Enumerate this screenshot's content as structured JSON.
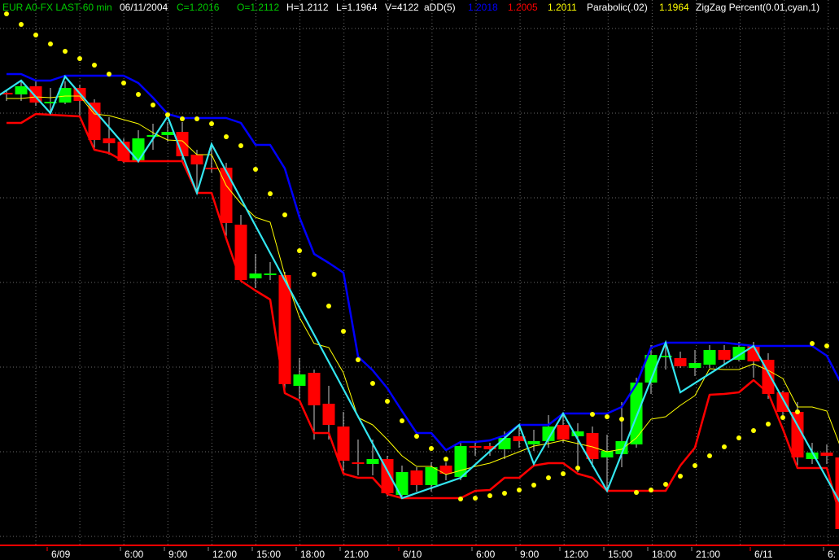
{
  "header": {
    "symbol": "EUR A0-FX LAST-60 min",
    "date": "06/11/2004",
    "close": "C=1.2016",
    "open": "O=1.2112",
    "high": "H=1.2112",
    "low": "L=1.1964",
    "volume": "V=4122",
    "add_label": "aDD(5)",
    "add_upper": "1.2018",
    "add_lower": "1.2005",
    "add_mid": "1.2011",
    "parabolic_label": "Parabolic(.02)",
    "parabolic_value": "1.1964",
    "zigzag_label": "ZigZag Percent(0.01,cyan,1)"
  },
  "colors": {
    "background": "#000000",
    "up": "#00ff00",
    "down": "#ff0000",
    "wick": "#c8c8c8",
    "upper_band": "#0000ff",
    "lower_band": "#ff0000",
    "mid_line": "#ffff00",
    "parabolic": "#ffff00",
    "zigzag": "#33e6f0",
    "header_green": "#00cc00",
    "text": "#ffffff"
  },
  "chart_data": {
    "type": "candlestick",
    "title": "EUR A0-FX LAST-60 min",
    "ylim": [
      1.19,
      1.2229
    ],
    "grid": true,
    "x_labels": [
      {
        "text": "6/09",
        "bar": 3,
        "date": true
      },
      {
        "text": "6:00",
        "bar": 8
      },
      {
        "text": "9:00",
        "bar": 11
      },
      {
        "text": "12:00",
        "bar": 14
      },
      {
        "text": "15:00",
        "bar": 17
      },
      {
        "text": "18:00",
        "bar": 20
      },
      {
        "text": "21:00",
        "bar": 23
      },
      {
        "text": "6/10",
        "bar": 27,
        "date": true
      },
      {
        "text": "6:00",
        "bar": 32
      },
      {
        "text": "9:00",
        "bar": 35
      },
      {
        "text": "12:00",
        "bar": 38
      },
      {
        "text": "15:00",
        "bar": 41
      },
      {
        "text": "18:00",
        "bar": 44
      },
      {
        "text": "21:00",
        "bar": 47
      },
      {
        "text": "6/11",
        "bar": 51,
        "date": true
      },
      {
        "text": "6:",
        "bar": 56
      }
    ],
    "ohlc": [
      [
        1.2172,
        1.2174,
        1.2167,
        1.2171
      ],
      [
        1.2171,
        1.2179,
        1.2167,
        1.2176
      ],
      [
        1.2176,
        1.2179,
        1.2164,
        1.2166
      ],
      [
        1.2166,
        1.2175,
        1.2159,
        1.21665
      ],
      [
        1.2166,
        1.2179,
        1.2165,
        1.2175
      ],
      [
        1.2175,
        1.2177,
        1.2157,
        1.2167
      ],
      [
        1.2166,
        1.2168,
        1.2137,
        1.2143
      ],
      [
        1.2144,
        1.2157,
        1.2134,
        1.2141
      ],
      [
        1.2142,
        1.2144,
        1.2129,
        1.213
      ],
      [
        1.213,
        1.2149,
        1.2129,
        1.2144
      ],
      [
        1.2145,
        1.2153,
        1.2137,
        1.2146
      ],
      [
        1.2146,
        1.2154,
        1.2142,
        1.2148
      ],
      [
        1.2148,
        1.2154,
        1.2129,
        1.2133
      ],
      [
        1.2134,
        1.2137,
        1.2111,
        1.2128
      ],
      [
        1.2126,
        1.2139,
        1.2123,
        1.2125
      ],
      [
        1.2126,
        1.2129,
        1.2083,
        1.2092
      ],
      [
        1.2091,
        1.2097,
        1.2057,
        1.2057
      ],
      [
        1.2058,
        1.2073,
        1.2052,
        1.2061
      ],
      [
        1.206,
        1.2068,
        1.2057,
        1.2061
      ],
      [
        1.206,
        1.2062,
        1.1989,
        1.1993
      ],
      [
        1.1992,
        1.2009,
        1.1984,
        1.1999
      ],
      [
        1.2,
        1.2002,
        1.1959,
        1.198
      ],
      [
        1.1981,
        1.1992,
        1.1959,
        1.1968
      ],
      [
        1.1967,
        1.1976,
        1.1939,
        1.1946
      ],
      [
        1.1945,
        1.1959,
        1.1937,
        1.1944
      ],
      [
        1.1944,
        1.1959,
        1.1937,
        1.1947
      ],
      [
        1.1947,
        1.1949,
        1.1924,
        1.1926
      ],
      [
        1.1925,
        1.1943,
        1.1924,
        1.1939
      ],
      [
        1.194,
        1.1942,
        1.1927,
        1.1931
      ],
      [
        1.1931,
        1.1945,
        1.1927,
        1.1942
      ],
      [
        1.1943,
        1.1945,
        1.1934,
        1.1938
      ],
      [
        1.1936,
        1.1957,
        1.1934,
        1.1955
      ],
      [
        1.1955,
        1.1957,
        1.1949,
        1.1954
      ],
      [
        1.1955,
        1.1957,
        1.1949,
        1.1953
      ],
      [
        1.1953,
        1.1964,
        1.1947,
        1.196
      ],
      [
        1.1961,
        1.1967,
        1.1954,
        1.1958
      ],
      [
        1.1956,
        1.1965,
        1.1952,
        1.1958
      ],
      [
        1.1958,
        1.1974,
        1.1954,
        1.1967
      ],
      [
        1.1968,
        1.1975,
        1.1957,
        1.1959
      ],
      [
        1.1961,
        1.1969,
        1.1939,
        1.1964
      ],
      [
        1.1963,
        1.1967,
        1.1942,
        1.1947
      ],
      [
        1.1948,
        1.1962,
        1.1927,
        1.1952
      ],
      [
        1.195,
        1.1982,
        1.1942,
        1.1958
      ],
      [
        1.1956,
        1.1997,
        1.1954,
        1.1994
      ],
      [
        1.1994,
        1.2017,
        1.1987,
        1.2011
      ],
      [
        1.201,
        1.2018,
        1.2002,
        1.20105
      ],
      [
        1.2009,
        1.2013,
        1.2003,
        1.2004
      ],
      [
        1.2003,
        1.2014,
        1.1998,
        1.2006
      ],
      [
        1.2005,
        1.2017,
        1.2003,
        1.2014
      ],
      [
        1.2014,
        1.2017,
        1.2005,
        1.2008
      ],
      [
        1.2008,
        1.2019,
        1.2007,
        1.2016
      ],
      [
        1.2017,
        1.2019,
        1.1997,
        1.2007
      ],
      [
        1.2008,
        1.2012,
        1.1984,
        1.1987
      ],
      [
        1.1988,
        1.1989,
        1.1974,
        1.1976
      ],
      [
        1.1976,
        1.1982,
        1.1943,
        1.1948
      ],
      [
        1.1947,
        1.1957,
        1.1944,
        1.1951
      ],
      [
        1.1951,
        1.1956,
        1.1944,
        1.1949
      ],
      [
        1.1948,
        1.1949,
        1.1902,
        1.1904
      ]
    ],
    "upper_band": [
      1.21835,
      1.21835,
      1.21795,
      1.21795,
      1.21825,
      1.21825,
      1.21825,
      1.21825,
      1.21825,
      1.2178,
      1.2169,
      1.2159,
      1.21565,
      1.21565,
      1.21565,
      1.21565,
      1.21535,
      1.214,
      1.214,
      1.21255,
      1.20955,
      1.2073,
      1.20675,
      1.20615,
      1.201,
      1.20015,
      1.19905,
      1.19765,
      1.1963,
      1.1963,
      1.19525,
      1.19575,
      1.19575,
      1.19585,
      1.19615,
      1.1968,
      1.1968,
      1.1968,
      1.1975,
      1.1975,
      1.1975,
      1.1975,
      1.1979,
      1.1993,
      1.20155,
      1.20185,
      1.20185,
      1.20185,
      1.20185,
      1.20185,
      1.20175,
      1.20165,
      1.20165,
      1.20165,
      1.20165,
      1.20165,
      1.20105,
      1.1993
    ],
    "lower_band": [
      1.21535,
      1.21535,
      1.2159,
      1.21585,
      1.2158,
      1.21575,
      1.2137,
      1.2135,
      1.213,
      1.213,
      1.213,
      1.213,
      1.213,
      1.21105,
      1.21105,
      1.20825,
      1.20565,
      1.20505,
      1.2045,
      1.19875,
      1.1983,
      1.1963,
      1.1963,
      1.1938,
      1.19355,
      1.19355,
      1.19255,
      1.1923,
      1.1923,
      1.1923,
      1.1923,
      1.1923,
      1.19275,
      1.1928,
      1.19355,
      1.19355,
      1.1943,
      1.19445,
      1.19445,
      1.1938,
      1.19355,
      1.19275,
      1.19275,
      1.19275,
      1.19275,
      1.19275,
      1.1943,
      1.1954,
      1.19865,
      1.1987,
      1.1988,
      1.19955,
      1.19875,
      1.19655,
      1.19415,
      1.19415,
      1.19415,
      1.1909
    ],
    "mid_line": [
      1.21685,
      1.21685,
      1.21695,
      1.2169,
      1.217,
      1.217,
      1.2159,
      1.2158,
      1.21555,
      1.2153,
      1.21475,
      1.2143,
      1.21425,
      1.2134,
      1.2134,
      1.2115,
      1.2104,
      1.20955,
      1.20925,
      1.206,
      1.2034,
      1.2018,
      1.20155,
      1.2,
      1.19725,
      1.1968,
      1.1959,
      1.1949,
      1.19425,
      1.19425,
      1.19375,
      1.194,
      1.19425,
      1.19445,
      1.1948,
      1.19515,
      1.1955,
      1.19565,
      1.19585,
      1.19565,
      1.19545,
      1.19515,
      1.1953,
      1.196,
      1.19715,
      1.1973,
      1.198,
      1.1986,
      1.20025,
      1.2002,
      1.2002,
      1.20055,
      1.20015,
      1.19965,
      1.1979,
      1.1979,
      1.19765,
      1.1953
    ],
    "parabolic": [
      1.22205,
      1.2214,
      1.22075,
      1.2202,
      1.21975,
      1.2193,
      1.2189,
      1.21835,
      1.2178,
      1.2171,
      1.21645,
      1.21585,
      1.2156,
      1.2156,
      1.2153,
      1.2145,
      1.21395,
      1.2125,
      1.211,
      1.2097,
      1.2075,
      1.20605,
      1.2041,
      1.20255,
      1.2008,
      1.19935,
      1.19825,
      1.19705,
      1.1961,
      1.19535,
      1.1947,
      1.19225,
      1.1923,
      1.19245,
      1.1926,
      1.1928,
      1.1931,
      1.19355,
      1.1938,
      1.19415,
      1.19745,
      1.1973,
      1.19715,
      1.19265,
      1.1928,
      1.19315,
      1.19365,
      1.1943,
      1.1949,
      1.19545,
      1.196,
      1.19645,
      1.19685,
      1.19725,
      1.1976,
      1.2018,
      1.20165
    ],
    "zigzag": [
      [
        -0.5,
        1.21705
      ],
      [
        1,
        1.21795
      ],
      [
        3,
        1.21595
      ],
      [
        4,
        1.2182
      ],
      [
        9,
        1.213
      ],
      [
        11,
        1.21575
      ],
      [
        13,
        1.21105
      ],
      [
        14,
        1.21405
      ],
      [
        27,
        1.1923
      ],
      [
        31,
        1.19355
      ],
      [
        35,
        1.1968
      ],
      [
        36,
        1.1944
      ],
      [
        38,
        1.1975
      ],
      [
        41,
        1.19275
      ],
      [
        45,
        1.20185
      ],
      [
        46,
        1.1988
      ],
      [
        51,
        1.20165
      ],
      [
        57.2,
        1.19155
      ]
    ]
  }
}
